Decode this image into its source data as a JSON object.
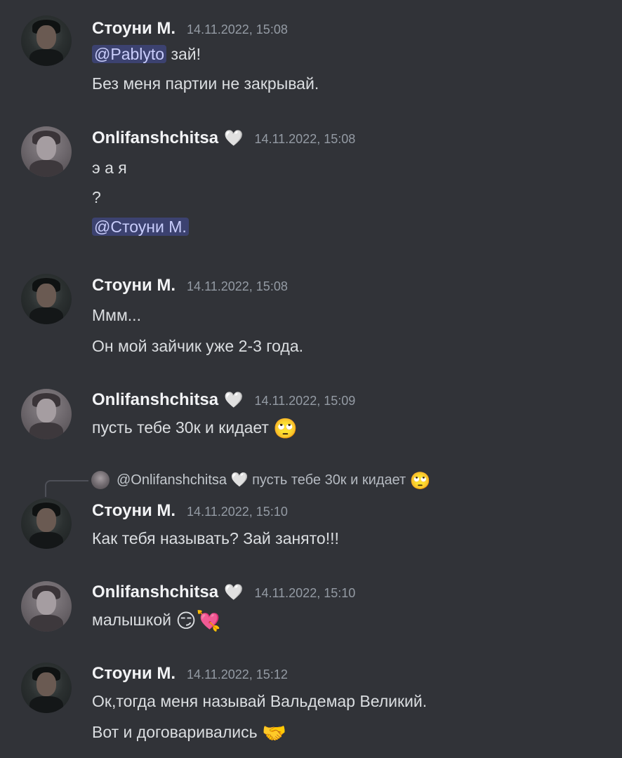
{
  "users": {
    "stoney": "Стоуни М.",
    "onli": "Onlifanshchitsa",
    "heart": "🤍"
  },
  "messages": [
    {
      "user": "Стоуни М.",
      "time": "14.11.2022, 15:08",
      "lines": [
        {
          "mention": "@Pablyto",
          "text": " зай!"
        },
        {
          "text": "Без меня партии не закрывай."
        }
      ]
    },
    {
      "user": "Onlifanshchitsa",
      "time": "14.11.2022, 15:08",
      "lines": [
        {
          "text": "э а я"
        },
        {
          "text": "?"
        },
        {
          "mention": "@Стоуни М."
        }
      ]
    },
    {
      "user": "Стоуни М.",
      "time": "14.11.2022, 15:08",
      "lines": [
        {
          "text": "Ммм..."
        },
        {
          "text": "Он мой зайчик уже 2-3 года."
        }
      ]
    },
    {
      "user": "Onlifanshchitsa",
      "time": "14.11.2022, 15:09",
      "lines": [
        {
          "text": "пусть тебе 30к и кидает",
          "emoji": "🙄"
        }
      ]
    },
    {
      "reply": {
        "user": "@Onlifanshchitsa",
        "heart": "🤍",
        "text": "пусть тебе 30к и кидает",
        "emoji": "🙄"
      },
      "user": "Стоуни М.",
      "time": "14.11.2022, 15:10",
      "lines": [
        {
          "text": "Как тебя называть? Зай занято!!!"
        }
      ]
    },
    {
      "user": "Onlifanshchitsa",
      "time": "14.11.2022, 15:10",
      "lines": [
        {
          "text": "малышкой",
          "emoji": "😏💘"
        }
      ]
    },
    {
      "user": "Стоуни М.",
      "time": "14.11.2022, 15:12",
      "lines": [
        {
          "text": "Ок,тогда меня называй Вальдемар Великий."
        },
        {
          "text": "Вот и договаривались",
          "emoji": "🤝"
        }
      ]
    }
  ]
}
